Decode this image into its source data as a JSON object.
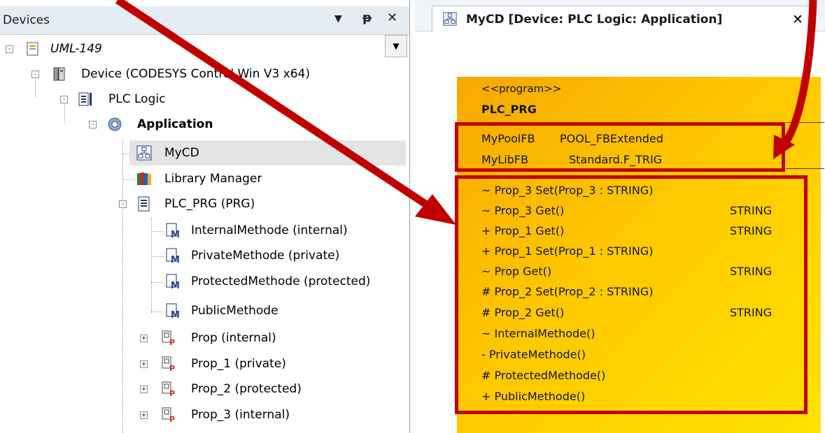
{
  "devices_pane": {
    "title": "Devices",
    "buttons": {
      "dropdown": "▼",
      "pin": "ᵽ",
      "close": "✕"
    },
    "tree": [
      {
        "label": "UML-149",
        "icon": "project-icon",
        "expander": "-"
      },
      {
        "label": "Device (CODESYS Control Win V3 x64)",
        "icon": "device-icon",
        "expander": "-"
      },
      {
        "label": "PLC Logic",
        "icon": "plc-logic-icon",
        "expander": "-"
      },
      {
        "label": "Application",
        "icon": "application-gear-icon",
        "expander": "-"
      },
      {
        "label": "MyCD",
        "icon": "class-diagram-icon"
      },
      {
        "label": "Library Manager",
        "icon": "library-books-icon"
      },
      {
        "label": "PLC_PRG (PRG)",
        "icon": "program-icon",
        "expander": "-"
      },
      {
        "label": "InternalMethode (internal)",
        "icon": "method-icon"
      },
      {
        "label": "PrivateMethode (private)",
        "icon": "method-icon"
      },
      {
        "label": "ProtectedMethode (protected)",
        "icon": "method-icon"
      },
      {
        "label": "PublicMethode",
        "icon": "method-icon"
      },
      {
        "label": "Prop (internal)",
        "icon": "property-icon",
        "expander": "+"
      },
      {
        "label": "Prop_1 (private)",
        "icon": "property-icon",
        "expander": "+"
      },
      {
        "label": "Prop_2 (protected)",
        "icon": "property-icon",
        "expander": "+"
      },
      {
        "label": "Prop_3 (internal)",
        "icon": "property-icon",
        "expander": "+"
      }
    ]
  },
  "editor": {
    "tab_title": "MyCD [Device: PLC Logic: Application]",
    "tab_close": "✕"
  },
  "uml": {
    "stereotype": "<<program>>",
    "name": "PLC_PRG",
    "variables": [
      {
        "name": "MyPoolFB",
        "type": "POOL_FBExtended"
      },
      {
        "name": "MyLibFB",
        "type": "Standard.F_TRIG"
      }
    ],
    "members": [
      {
        "text": "~ Prop_3 Set(Prop_3 : STRING)",
        "ret": ""
      },
      {
        "text": "~ Prop_3 Get()",
        "ret": "STRING"
      },
      {
        "text": "+ Prop_1 Get()",
        "ret": "STRING"
      },
      {
        "text": "+ Prop_1 Set(Prop_1 : STRING)",
        "ret": ""
      },
      {
        "text": "~ Prop Get()",
        "ret": "STRING"
      },
      {
        "text": "# Prop_2 Set(Prop_2 : STRING)",
        "ret": ""
      },
      {
        "text": "# Prop_2 Get()",
        "ret": "STRING"
      },
      {
        "text": "~ InternalMethode()",
        "ret": ""
      },
      {
        "text": "- PrivateMethode()",
        "ret": ""
      },
      {
        "text": "# ProtectedMethode()",
        "ret": ""
      },
      {
        "text": "+ PublicMethode()",
        "ret": ""
      }
    ]
  },
  "colors": {
    "annotation_red": "#c00000",
    "selected_row": "#e4e4e4",
    "uml_fill_start": "#f6a800",
    "uml_fill_end": "#ffe200"
  }
}
